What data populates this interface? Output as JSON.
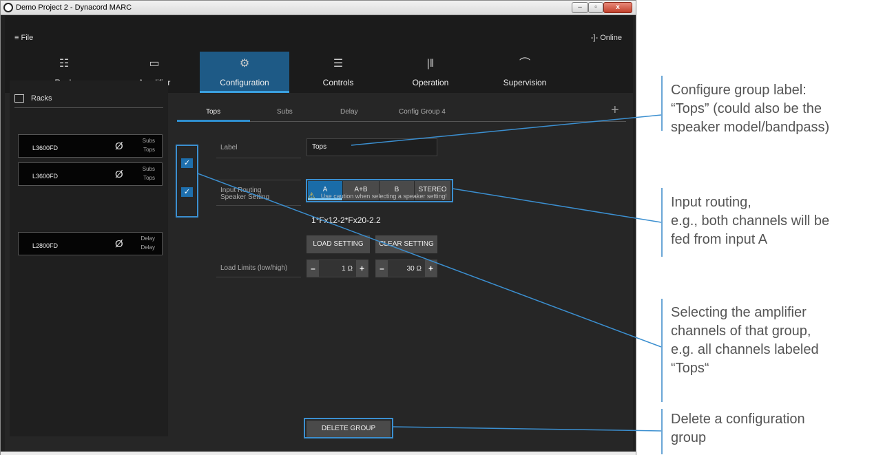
{
  "window": {
    "title": "Demo Project 2 - Dynacord MARC",
    "controls": [
      "–",
      "▫",
      "x"
    ]
  },
  "menubar": {
    "file": "≡ File",
    "online": "-]- Online"
  },
  "nav_tabs": [
    {
      "label": "Rack",
      "icon": "rack-icon",
      "glyph": "☷"
    },
    {
      "label": "Amplifier",
      "icon": "amplifier-icon",
      "glyph": "▭"
    },
    {
      "label": "Configuration",
      "icon": "gear-icon",
      "glyph": "⚙",
      "active": true
    },
    {
      "label": "Controls",
      "icon": "sliders-icon",
      "glyph": "☰"
    },
    {
      "label": "Operation",
      "icon": "fader-icon",
      "glyph": "|‖"
    },
    {
      "label": "Supervision",
      "icon": "eye-icon",
      "glyph": "⌒"
    }
  ],
  "sidebar": {
    "title": "Racks",
    "devices": [
      {
        "name": "L3600FD",
        "ch1": "Subs",
        "ch2": "Tops",
        "symbol": "Ø"
      },
      {
        "name": "L3600FD",
        "ch1": "Subs",
        "ch2": "Tops",
        "symbol": "Ø"
      },
      {
        "name": "L2800FD",
        "ch1": "Delay",
        "ch2": "Delay",
        "symbol": "Ø"
      }
    ],
    "checkmark": "✓"
  },
  "group_tabs": [
    "Tops",
    "Subs",
    "Delay",
    "Config Group 4"
  ],
  "add_symbol": "+",
  "form": {
    "label_field": "Label",
    "label_value": "Tops",
    "input_routing": "Input Routing",
    "routing_options": [
      "A",
      "A+B",
      "B",
      "STEREO"
    ],
    "speaker_setting": "Speaker Setting",
    "caution": "Use caution when selecting a speaker setting!",
    "warn_glyph": "⚠",
    "speaker_name": "1*Fx12-2*Fx20-2.2",
    "load_setting": "LOAD SETTING",
    "clear_setting": "CLEAR SETTING",
    "load_limits": "Load Limits (low/high)",
    "low_value": "1 Ω",
    "high_value": "30 Ω",
    "minus": "–",
    "plus": "+",
    "delete_group": "DELETE GROUP"
  },
  "annotations": [
    {
      "lines": [
        "Configure group label:",
        "“Tops” (could also be the",
        "speaker model/bandpass)"
      ]
    },
    {
      "lines": [
        "Input routing,",
        "e.g., both channels will be",
        "fed from input A"
      ]
    },
    {
      "lines": [
        "Selecting the amplifier",
        "channels of that  group,",
        "e.g. all channels labeled",
        "“Tops“"
      ]
    },
    {
      "lines": [
        "Delete a configuration",
        "group"
      ]
    }
  ],
  "colors": {
    "accent": "#1e5a86",
    "highlight": "#3b8fd0",
    "annotation_text": "#555555"
  }
}
